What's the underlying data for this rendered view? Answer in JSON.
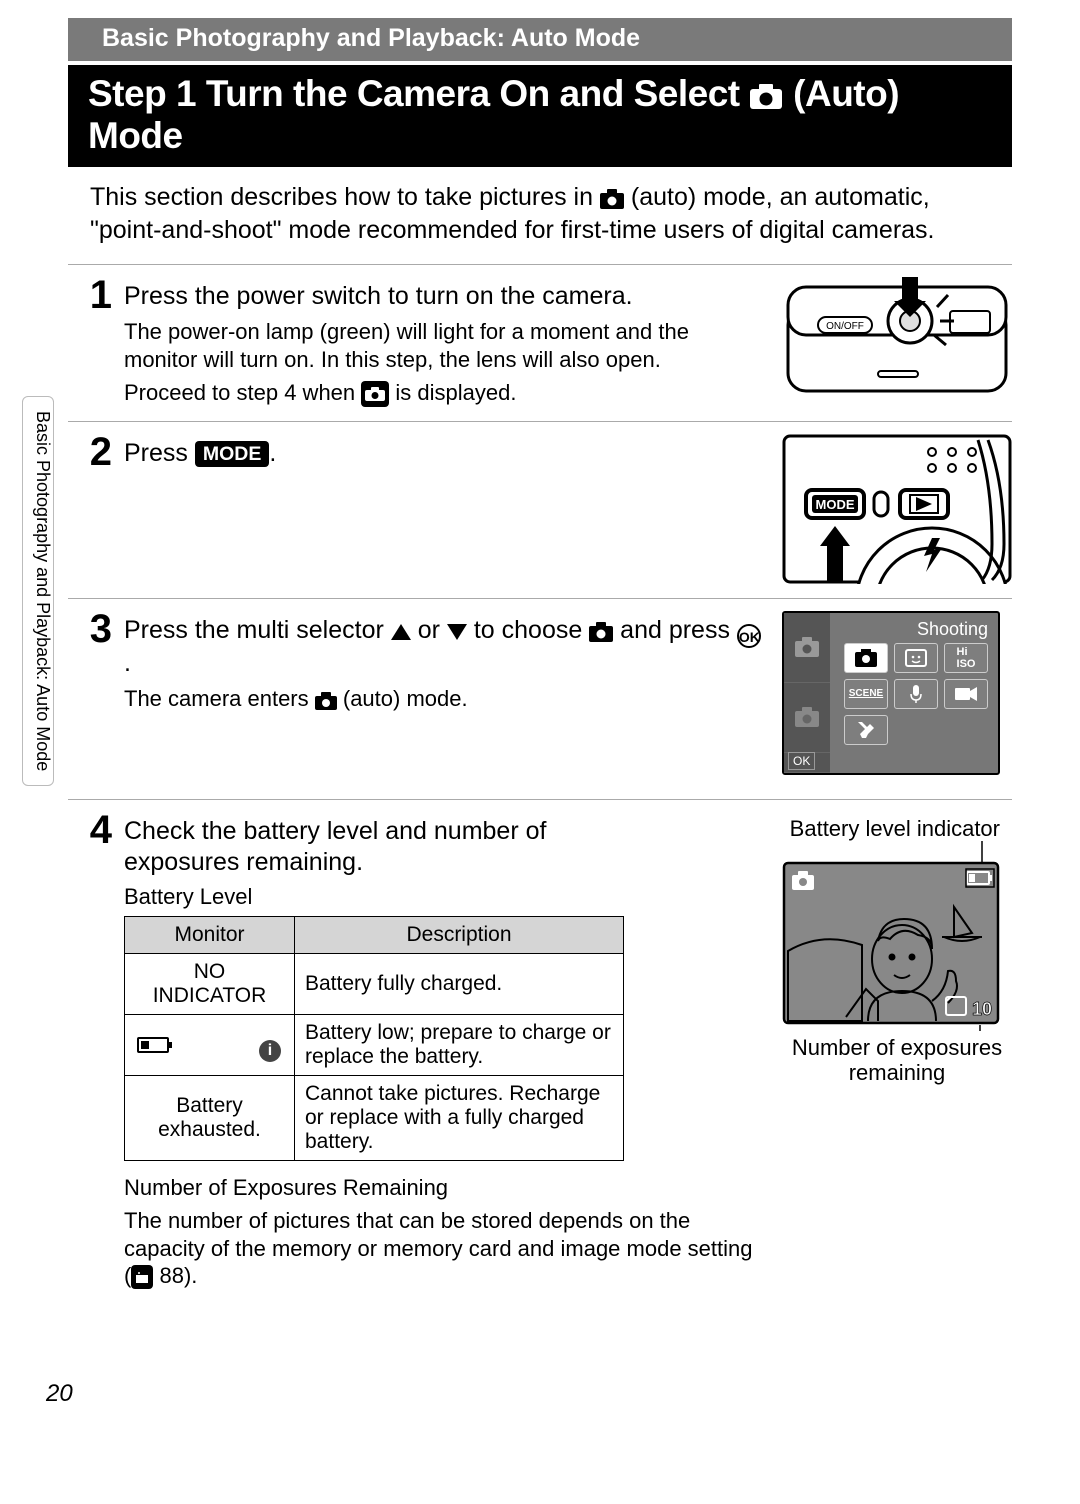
{
  "header_bar": "Basic Photography and Playback: Auto Mode",
  "main_title_prefix": "Step 1 Turn the Camera On and Select ",
  "main_title_suffix": " (Auto) Mode",
  "intro_a": "This section describes how to take pictures in ",
  "intro_b": " (auto) mode, an automatic, \"point-and-shoot\" mode recommended for first-time users of digital cameras.",
  "side_tab": "Basic Photography and Playback: Auto Mode",
  "steps": {
    "s1": {
      "num": "1",
      "title": "Press the power switch to turn on the camera.",
      "desc1": "The power-on lamp (green) will light for a moment and the monitor will turn on. In this step, the lens will also open.",
      "desc2_a": "Proceed to step 4 when ",
      "desc2_b": " is displayed.",
      "onoff": "ON/OFF"
    },
    "s2": {
      "num": "2",
      "title_a": "Press ",
      "mode_badge": "MODE",
      "title_b": ".",
      "back_mode_label": "MODE"
    },
    "s3": {
      "num": "3",
      "title_a": "Press the multi selector ",
      "title_b": " or ",
      "title_c": " to choose ",
      "title_d": " and press ",
      "ok": "OK",
      "title_e": ".",
      "desc_a": "The camera enters ",
      "desc_b": " (auto) mode.",
      "screen": {
        "title": "Shooting",
        "ok": "OK",
        "scene": "SCENE",
        "hi_iso": "Hi\nISO"
      }
    },
    "s4": {
      "num": "4",
      "title": "Check the battery level and number of exposures remaining.",
      "batt_heading": "Battery Level",
      "table": {
        "h1": "Monitor",
        "h2": "Description",
        "r1m": "NO INDICATOR",
        "r1d": "Battery fully charged.",
        "r2d": "Battery low; prepare to charge or replace the battery.",
        "r3m": "Battery exhausted.",
        "r3d": "Cannot take pictures. Recharge or replace with a fully charged battery."
      },
      "info_glyph": "i",
      "exp_heading": "Number of Exposures Remaining",
      "exp_desc_a": "The number of pictures that can be stored depends on the capacity of the memory or memory card and image mode setting (",
      "exp_ref": "88",
      "exp_desc_b": ").",
      "callout_top": "Battery level indicator",
      "callout_bottom": "Number of exposures remaining",
      "remaining_count": "10"
    }
  },
  "page_number": "20"
}
